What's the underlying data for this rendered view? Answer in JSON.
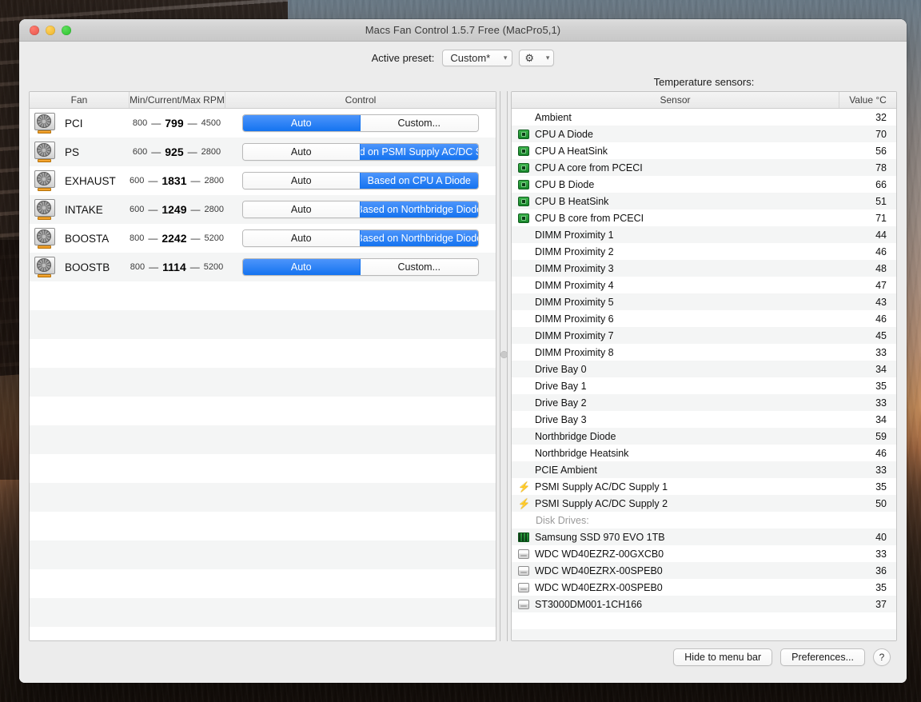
{
  "window": {
    "title": "Macs Fan Control 1.5.7 Free (MacPro5,1)",
    "traffic": {
      "close": "close-button",
      "minimize": "minimize-button",
      "zoom": "zoom-button"
    }
  },
  "toolbar": {
    "preset_label": "Active preset:",
    "preset_value": "Custom*",
    "gear_icon": "gear-icon",
    "chevron_icon": "chevron-down-icon"
  },
  "fans": {
    "columns": [
      "Fan",
      "Min/Current/Max RPM",
      "Control"
    ],
    "rows": [
      {
        "name": "PCI",
        "min": "800",
        "current": "799",
        "max": "4500",
        "auto_label": "Auto",
        "auto_on": true,
        "mode_label": "Custom...",
        "mode_on": false
      },
      {
        "name": "PS",
        "min": "600",
        "current": "925",
        "max": "2800",
        "auto_label": "Auto",
        "auto_on": false,
        "mode_label": "Based on PSMI Supply AC/DC Sup...",
        "mode_on": true
      },
      {
        "name": "EXHAUST",
        "min": "600",
        "current": "1831",
        "max": "2800",
        "auto_label": "Auto",
        "auto_on": false,
        "mode_label": "Based on CPU A Diode",
        "mode_on": true
      },
      {
        "name": "INTAKE",
        "min": "600",
        "current": "1249",
        "max": "2800",
        "auto_label": "Auto",
        "auto_on": false,
        "mode_label": "Based on Northbridge Diode",
        "mode_on": true
      },
      {
        "name": "BOOSTA",
        "min": "800",
        "current": "2242",
        "max": "5200",
        "auto_label": "Auto",
        "auto_on": false,
        "mode_label": "Based on Northbridge Diode",
        "mode_on": true
      },
      {
        "name": "BOOSTB",
        "min": "800",
        "current": "1114",
        "max": "5200",
        "auto_label": "Auto",
        "auto_on": true,
        "mode_label": "Custom...",
        "mode_on": false
      }
    ]
  },
  "sensors": {
    "caption": "Temperature sensors:",
    "columns": [
      "Sensor",
      "Value °C"
    ],
    "rows": [
      {
        "icon": "none",
        "name": "Ambient",
        "value": "32"
      },
      {
        "icon": "cpu",
        "name": "CPU A Diode",
        "value": "70"
      },
      {
        "icon": "cpu",
        "name": "CPU A HeatSink",
        "value": "56"
      },
      {
        "icon": "cpu",
        "name": "CPU A core from PCECI",
        "value": "78"
      },
      {
        "icon": "cpu",
        "name": "CPU B Diode",
        "value": "66"
      },
      {
        "icon": "cpu",
        "name": "CPU B HeatSink",
        "value": "51"
      },
      {
        "icon": "cpu",
        "name": "CPU B core from PCECI",
        "value": "71"
      },
      {
        "icon": "none",
        "name": "DIMM Proximity 1",
        "value": "44"
      },
      {
        "icon": "none",
        "name": "DIMM Proximity 2",
        "value": "46"
      },
      {
        "icon": "none",
        "name": "DIMM Proximity 3",
        "value": "48"
      },
      {
        "icon": "none",
        "name": "DIMM Proximity 4",
        "value": "47"
      },
      {
        "icon": "none",
        "name": "DIMM Proximity 5",
        "value": "43"
      },
      {
        "icon": "none",
        "name": "DIMM Proximity 6",
        "value": "46"
      },
      {
        "icon": "none",
        "name": "DIMM Proximity 7",
        "value": "45"
      },
      {
        "icon": "none",
        "name": "DIMM Proximity 8",
        "value": "33"
      },
      {
        "icon": "none",
        "name": "Drive Bay 0",
        "value": "34"
      },
      {
        "icon": "none",
        "name": "Drive Bay 1",
        "value": "35"
      },
      {
        "icon": "none",
        "name": "Drive Bay 2",
        "value": "33"
      },
      {
        "icon": "none",
        "name": "Drive Bay 3",
        "value": "34"
      },
      {
        "icon": "none",
        "name": "Northbridge Diode",
        "value": "59"
      },
      {
        "icon": "none",
        "name": "Northbridge Heatsink",
        "value": "46"
      },
      {
        "icon": "none",
        "name": "PCIE Ambient",
        "value": "33"
      },
      {
        "icon": "bolt",
        "name": "PSMI Supply AC/DC Supply 1",
        "value": "35"
      },
      {
        "icon": "bolt",
        "name": "PSMI Supply AC/DC Supply 2",
        "value": "50"
      },
      {
        "icon": "none",
        "name": "Disk Drives:",
        "value": "",
        "group": true
      },
      {
        "icon": "ssd",
        "name": "Samsung SSD 970 EVO 1TB",
        "value": "40"
      },
      {
        "icon": "hdd",
        "name": "WDC WD40EZRZ-00GXCB0",
        "value": "33"
      },
      {
        "icon": "hdd",
        "name": "WDC WD40EZRX-00SPEB0",
        "value": "36"
      },
      {
        "icon": "hdd",
        "name": "WDC WD40EZRX-00SPEB0",
        "value": "35"
      },
      {
        "icon": "hdd",
        "name": "ST3000DM001-1CH166",
        "value": "37"
      }
    ]
  },
  "footer": {
    "hide_label": "Hide to menu bar",
    "preferences_label": "Preferences...",
    "help_label": "?"
  },
  "colors": {
    "accent_blue": "#1473f0",
    "window_bg": "#ececec",
    "row_alt": "#f4f5f5"
  }
}
